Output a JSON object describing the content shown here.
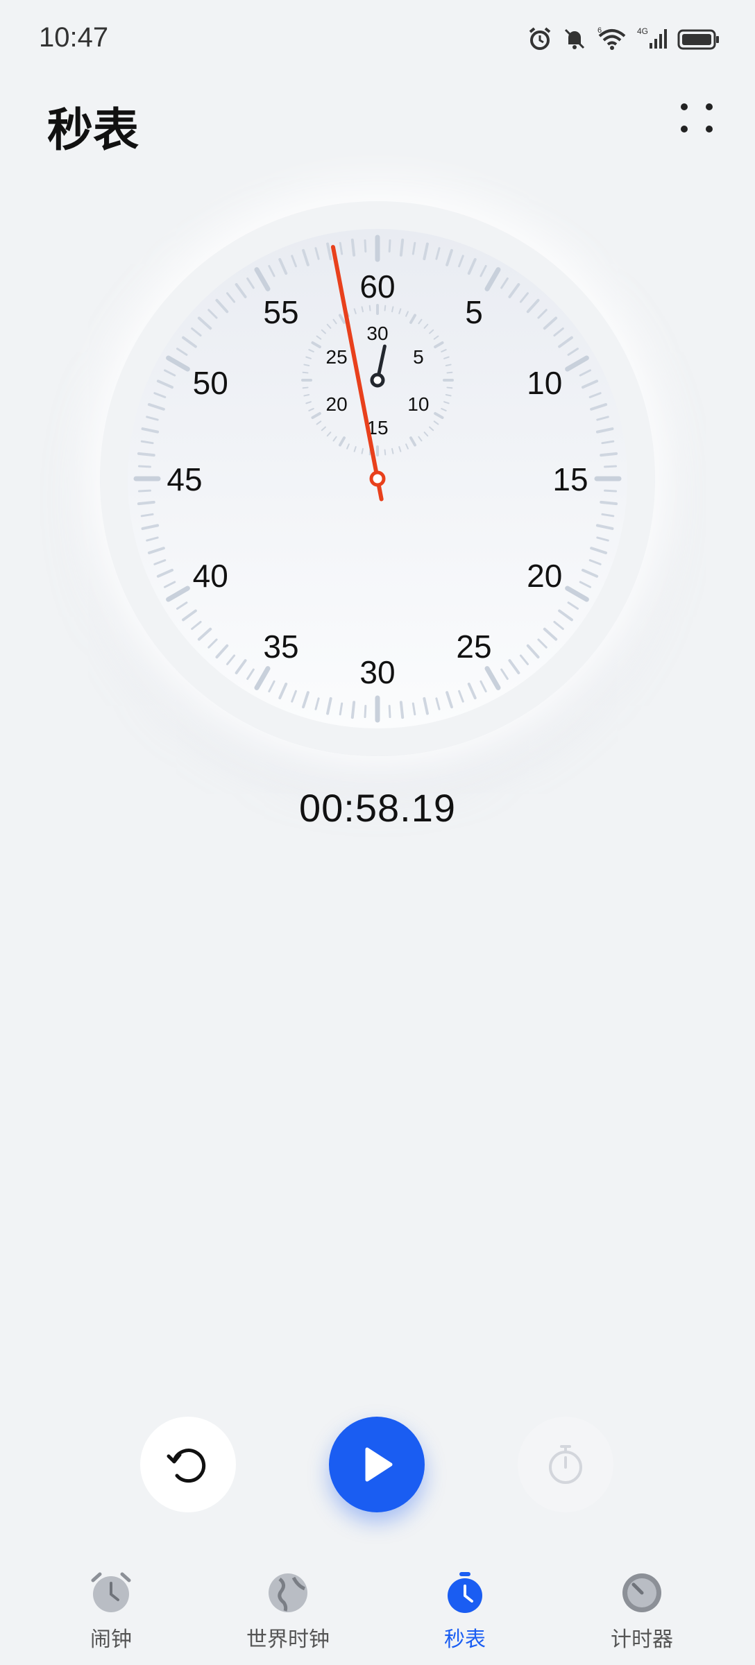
{
  "status_bar": {
    "time": "10:47",
    "network": "4G",
    "wifi_badge": "6",
    "icons": [
      "alarm-icon",
      "mute-icon",
      "wifi-icon",
      "signal-icon",
      "battery-icon"
    ]
  },
  "header": {
    "title": "秒表",
    "more_icon": "more-dots-icon"
  },
  "dial": {
    "outer_labels": [
      "60",
      "5",
      "10",
      "15",
      "20",
      "25",
      "30",
      "35",
      "40",
      "45",
      "50",
      "55"
    ],
    "inner_labels": [
      "30",
      "5",
      "10",
      "15",
      "20",
      "25"
    ],
    "second_hand_value": 58.19,
    "minute_hand_value": 1,
    "colors": {
      "second_hand": "#e8401c",
      "minute_hand": "#23272e",
      "ticks": "#cfd6e0"
    }
  },
  "elapsed": "00:58.19",
  "controls": {
    "reset_icon": "reset-icon",
    "play_icon": "play-icon",
    "lap_icon": "lap-timer-icon",
    "accent": "#1a5df2"
  },
  "nav": {
    "items": [
      {
        "label": "闹钟",
        "icon": "alarm-clock-icon",
        "active": false
      },
      {
        "label": "世界时钟",
        "icon": "globe-icon",
        "active": false
      },
      {
        "label": "秒表",
        "icon": "stopwatch-icon",
        "active": true
      },
      {
        "label": "计时器",
        "icon": "timer-icon",
        "active": false
      }
    ]
  }
}
